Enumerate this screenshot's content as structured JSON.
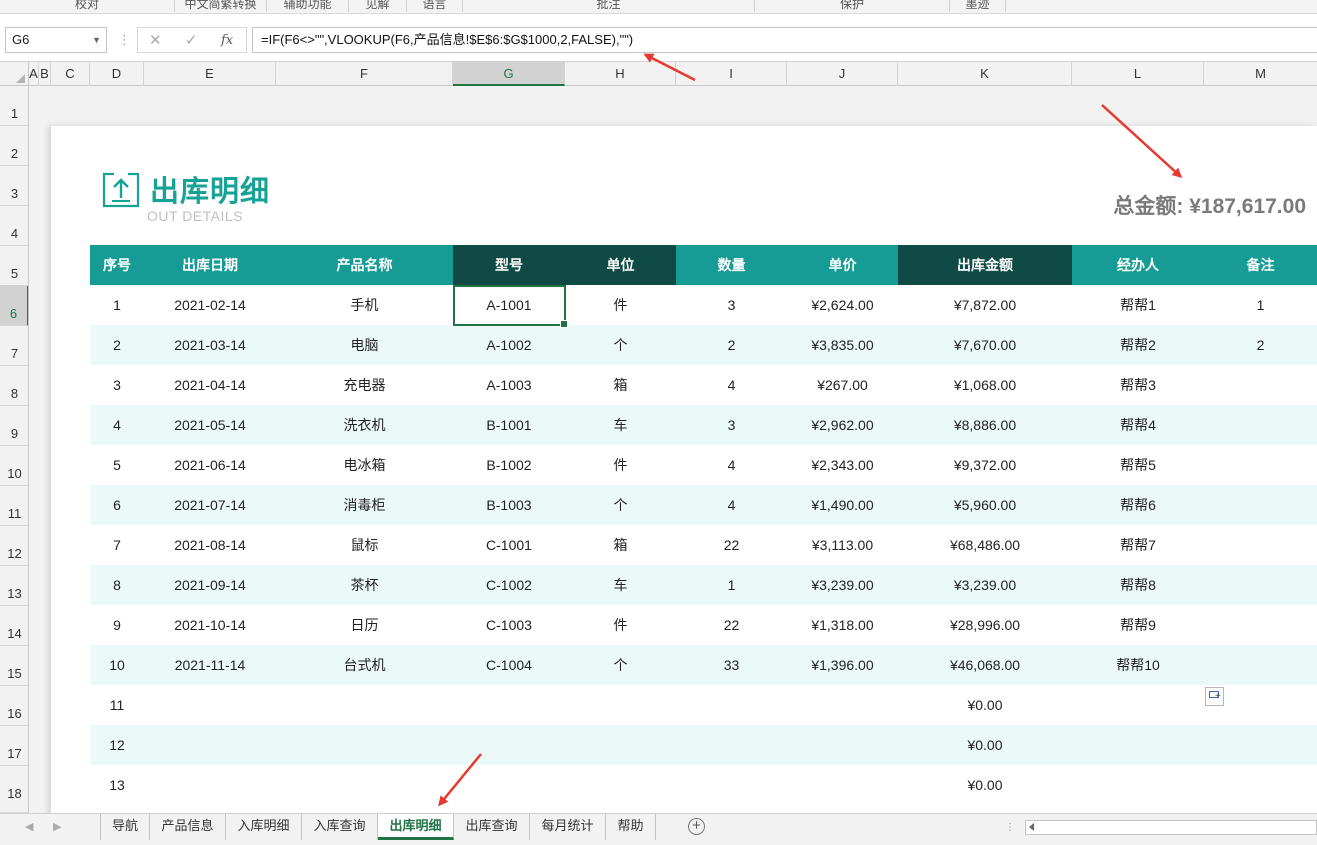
{
  "ribbon": {
    "groups": [
      "校对",
      "中文简繁转换",
      "辅助功能",
      "见解",
      "语言",
      "批注",
      "保护",
      "墨迹"
    ]
  },
  "formula_bar": {
    "name_box": "G6",
    "fx": "fx",
    "formula": "=IF(F6<>\"\",VLOOKUP(F6,产品信息!$E$6:$G$1000,2,FALSE),\"\")"
  },
  "columns": [
    "A",
    "B",
    "C",
    "D",
    "E",
    "F",
    "G",
    "H",
    "I",
    "J",
    "K",
    "L",
    "M"
  ],
  "rows": [
    "1",
    "2",
    "3",
    "4",
    "5",
    "6",
    "7",
    "8",
    "9",
    "10",
    "11",
    "12",
    "13",
    "14",
    "15",
    "16",
    "17",
    "18"
  ],
  "report": {
    "title": "出库明细",
    "subtitle": "OUT DETAILS",
    "total": "总金额: ¥187,617.00"
  },
  "table": {
    "headers": [
      "序号",
      "出库日期",
      "产品名称",
      "型号",
      "单位",
      "数量",
      "单价",
      "出库金额",
      "经办人",
      "备注"
    ],
    "rows": [
      [
        "1",
        "2021-02-14",
        "手机",
        "A-1001",
        "件",
        "3",
        "¥2,624.00",
        "¥7,872.00",
        "帮帮1",
        "1"
      ],
      [
        "2",
        "2021-03-14",
        "电脑",
        "A-1002",
        "个",
        "2",
        "¥3,835.00",
        "¥7,670.00",
        "帮帮2",
        "2"
      ],
      [
        "3",
        "2021-04-14",
        "充电器",
        "A-1003",
        "箱",
        "4",
        "¥267.00",
        "¥1,068.00",
        "帮帮3",
        ""
      ],
      [
        "4",
        "2021-05-14",
        "洗衣机",
        "B-1001",
        "车",
        "3",
        "¥2,962.00",
        "¥8,886.00",
        "帮帮4",
        ""
      ],
      [
        "5",
        "2021-06-14",
        "电冰箱",
        "B-1002",
        "件",
        "4",
        "¥2,343.00",
        "¥9,372.00",
        "帮帮5",
        ""
      ],
      [
        "6",
        "2021-07-14",
        "消毒柜",
        "B-1003",
        "个",
        "4",
        "¥1,490.00",
        "¥5,960.00",
        "帮帮6",
        ""
      ],
      [
        "7",
        "2021-08-14",
        "鼠标",
        "C-1001",
        "箱",
        "22",
        "¥3,113.00",
        "¥68,486.00",
        "帮帮7",
        ""
      ],
      [
        "8",
        "2021-09-14",
        "茶杯",
        "C-1002",
        "车",
        "1",
        "¥3,239.00",
        "¥3,239.00",
        "帮帮8",
        ""
      ],
      [
        "9",
        "2021-10-14",
        "日历",
        "C-1003",
        "件",
        "22",
        "¥1,318.00",
        "¥28,996.00",
        "帮帮9",
        ""
      ],
      [
        "10",
        "2021-11-14",
        "台式机",
        "C-1004",
        "个",
        "33",
        "¥1,396.00",
        "¥46,068.00",
        "帮帮10",
        ""
      ],
      [
        "11",
        "",
        "",
        "",
        "",
        "",
        "",
        "¥0.00",
        "",
        ""
      ],
      [
        "12",
        "",
        "",
        "",
        "",
        "",
        "",
        "¥0.00",
        "",
        ""
      ],
      [
        "13",
        "",
        "",
        "",
        "",
        "",
        "",
        "¥0.00",
        "",
        ""
      ]
    ]
  },
  "sheet_tabs": [
    "导航",
    "产品信息",
    "入库明细",
    "入库查询",
    "出库明细",
    "出库查询",
    "每月统计",
    "帮助"
  ],
  "active_tab": "出库明细",
  "colors": {
    "header_teal": "#169c94",
    "header_dark": "#0f4a45",
    "title_teal": "#16a396",
    "excel_green": "#217346",
    "arrow_red": "#e8382f"
  },
  "icons": [
    "upload-box-icon",
    "name-box-dropdown-icon",
    "cancel-icon",
    "enter-icon",
    "function-icon",
    "add-sheet-icon",
    "paste-options-icon"
  ]
}
